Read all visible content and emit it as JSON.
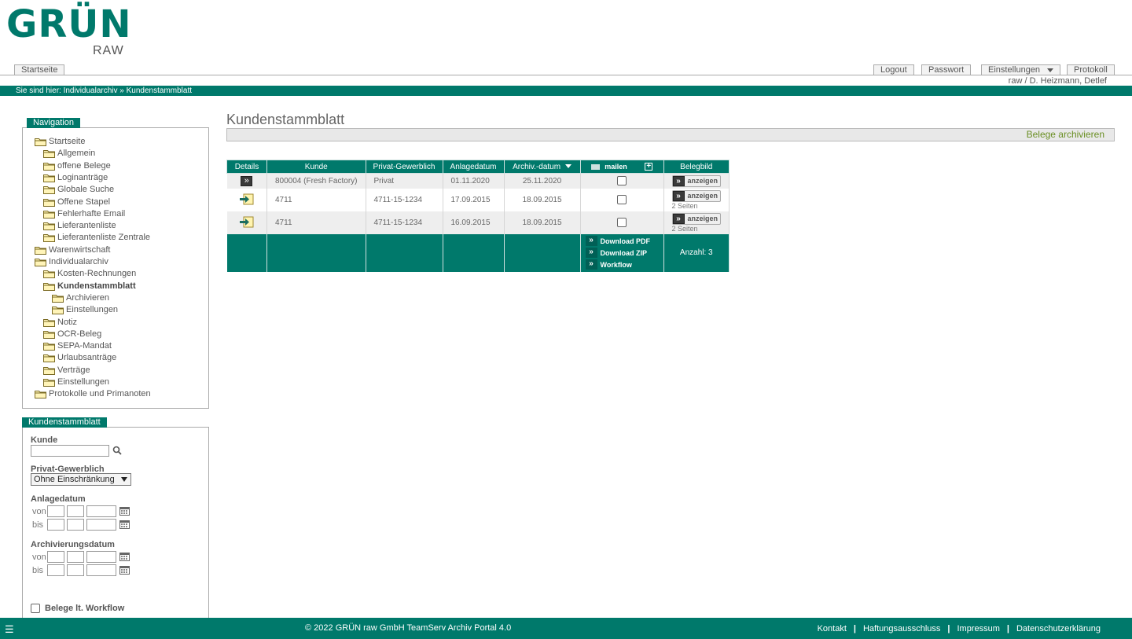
{
  "brand": {
    "name": "GRÜN",
    "sub": "RAW"
  },
  "header": {
    "start_tab": "Startseite",
    "logout": "Logout",
    "password": "Passwort",
    "settings": "Einstellungen",
    "protocol": "Protokoll",
    "user": "raw / D. Heizmann, Detlef",
    "breadcrumb": "Sie sind hier: Individualarchiv » Kundenstammblatt"
  },
  "navigation": {
    "title": "Navigation",
    "items": [
      {
        "label": "Startseite",
        "level": 0
      },
      {
        "label": "Allgemein",
        "level": 1
      },
      {
        "label": "offene Belege",
        "level": 1
      },
      {
        "label": "Loginanträge",
        "level": 1
      },
      {
        "label": "Globale Suche",
        "level": 1
      },
      {
        "label": "Offene Stapel",
        "level": 1
      },
      {
        "label": "Fehlerhafte Email",
        "level": 1
      },
      {
        "label": "Lieferantenliste",
        "level": 1
      },
      {
        "label": "Lieferantenliste Zentrale",
        "level": 1
      },
      {
        "label": "Warenwirtschaft",
        "level": 0
      },
      {
        "label": "Individualarchiv",
        "level": 0
      },
      {
        "label": "Kosten-Rechnungen",
        "level": 1
      },
      {
        "label": "Kundenstammblatt",
        "level": 1,
        "active": true
      },
      {
        "label": "Archivieren",
        "level": 2
      },
      {
        "label": "Einstellungen",
        "level": 2
      },
      {
        "label": "Notiz",
        "level": 1
      },
      {
        "label": "OCR-Beleg",
        "level": 1
      },
      {
        "label": "SEPA-Mandat",
        "level": 1
      },
      {
        "label": "Urlaubsanträge",
        "level": 1
      },
      {
        "label": "Verträge",
        "level": 1
      },
      {
        "label": "Einstellungen",
        "level": 1
      },
      {
        "label": "Protokolle und Primanoten",
        "level": 0
      }
    ]
  },
  "filter": {
    "title": "Kundenstammblatt",
    "kunde_label": "Kunde",
    "kunde_value": "",
    "privat_label": "Privat-Gewerblich",
    "privat_selected": "Ohne Einschränkung",
    "anlage_label": "Anlagedatum",
    "archiv_label": "Archivierungsdatum",
    "von": "von",
    "bis": "bis",
    "workflow_label": "Belege lt. Workflow",
    "workflow_checked": false
  },
  "main": {
    "title": "Kundenstammblatt",
    "archive_link": "Belege archivieren",
    "columns": {
      "details": "Details",
      "kunde": "Kunde",
      "privat": "Privat-Gewerblich",
      "anlage": "Anlagedatum",
      "archiv": "Archiv.-datum",
      "mail": "mailen",
      "belegbild": "Belegbild"
    },
    "rows": [
      {
        "icon": "arrow",
        "kunde": "800004 (Fresh Factory)",
        "privat": "Privat",
        "anlage": "01.11.2020",
        "archiv": "25.11.2020",
        "show": "anzeigen",
        "pages": ""
      },
      {
        "icon": "doc",
        "kunde": "4711",
        "privat": "4711-15-1234",
        "anlage": "17.09.2015",
        "archiv": "18.09.2015",
        "show": "anzeigen",
        "pages": "2 Seiten"
      },
      {
        "icon": "doc",
        "kunde": "4711",
        "privat": "4711-15-1234",
        "anlage": "16.09.2015",
        "archiv": "18.09.2015",
        "show": "anzeigen",
        "pages": "2 Seiten"
      }
    ],
    "footer": {
      "download_pdf": "Download PDF",
      "download_zip": "Download ZIP",
      "workflow": "Workflow",
      "count": "Anzahl: 3"
    }
  },
  "footer": {
    "copyright": "© 2022 GRÜN raw GmbH TeamServ Archiv Portal 4.0",
    "links": [
      "Kontakt",
      "Haftungsausschluss",
      "Impressum",
      "Datenschutzerklärung"
    ]
  },
  "colors": {
    "accent": "#00796b",
    "link_green": "#6a8f23"
  }
}
